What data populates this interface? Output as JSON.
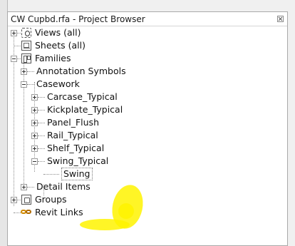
{
  "panel": {
    "title": "CW Cupbd.rfa - Project Browser"
  },
  "tree": {
    "views": "Views (all)",
    "sheets": "Sheets (all)",
    "families": "Families",
    "annotation_symbols": "Annotation Symbols",
    "casework": "Casework",
    "carcase_typical": "Carcase_Typical",
    "kickplate_typical": "Kickplate_Typical",
    "panel_flush": "Panel_Flush",
    "rail_typical": "Rail_Typical",
    "shelf_typical": "Shelf_Typical",
    "swing_typical": "Swing_Typical",
    "swing": "Swing",
    "detail_items": "Detail Items",
    "groups": "Groups",
    "revit_links": "Revit Links"
  },
  "colors": {
    "highlight": "#fff300",
    "link_icon": "#d08a00"
  },
  "icons": {
    "views": "views-icon",
    "sheets": "sheets-icon",
    "families": "families-icon",
    "groups": "groups-icon",
    "revit_links": "revit-links-icon",
    "close": "close-icon"
  }
}
